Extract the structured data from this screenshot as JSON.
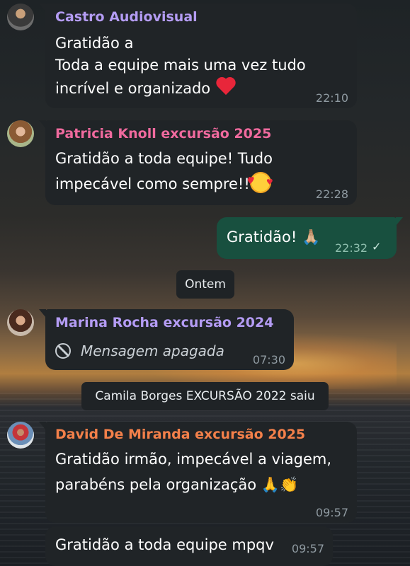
{
  "messages": [
    {
      "sender": "Castro Audiovisual",
      "sender_color": "#b49cf4",
      "lines": [
        "Gratidão a",
        "Toda a equipe mais uma vez tudo",
        "incrível e organizado"
      ],
      "emoji": "red-heart",
      "time": "22:10"
    },
    {
      "sender": "Patricia Knoll excursão 2025",
      "sender_color": "#f06a9e",
      "lines": [
        "Gratidão a toda equipe! Tudo",
        "impecável como sempre!!"
      ],
      "emoji": "smiling-face-with-hearts",
      "time": "22:28"
    },
    {
      "outgoing": true,
      "text": "Gratidão! 🙏🏼",
      "time": "22:32",
      "status": "✓"
    },
    {
      "sender": "Marina Rocha excursão 2024",
      "sender_color": "#b49cf4",
      "deleted_text": "Mensagem apagada",
      "time": "07:30"
    },
    {
      "sender": "David De Miranda excursão 2025",
      "sender_color": "#f3804a",
      "lines": [
        "Gratidão irmão, impecável a viagem,",
        "parabéns pela organização 🙏👏"
      ],
      "time": "09:57"
    },
    {
      "text": "Gratidão a toda equipe mpqv",
      "time": "09:57"
    }
  ],
  "date_divider": "Ontem",
  "system_notice": "Camila Borges EXCURSÃO 2022 saiu"
}
